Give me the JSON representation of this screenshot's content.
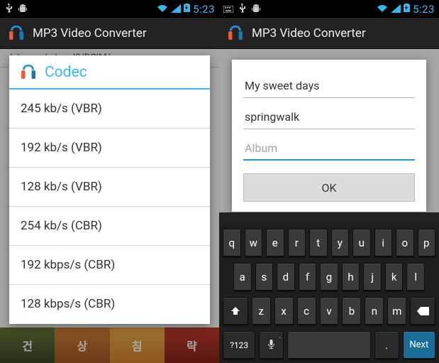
{
  "status": {
    "time": "5:23",
    "icons_left": [
      "usb",
      "android-debug"
    ],
    "icons_left_right_variant": [
      "keyboard",
      "usb",
      "android-debug"
    ],
    "icons_right": [
      "wifi",
      "signal",
      "battery-charging"
    ]
  },
  "action_bar": {
    "title": "MP3 Video Converter"
  },
  "left_panel": {
    "path": "/storage/sdcard0/DCIM/",
    "dialog_title": "Codec",
    "options": [
      "245 kb/s (VBR)",
      "192  kb/s (VBR)",
      "128  kb/s (VBR)",
      "254 kb/s (CBR)",
      "192 kbps/s (CBR)",
      "128 kbps/s (CBR)"
    ],
    "ads": [
      "건",
      "상",
      "침",
      "략"
    ]
  },
  "right_panel": {
    "fields": {
      "title": "My sweet days",
      "artist": "springwalk",
      "album_value": "",
      "album_placeholder": "Album"
    },
    "ok_label": "OK"
  },
  "keyboard": {
    "row1": [
      "q",
      "w",
      "e",
      "r",
      "t",
      "y",
      "u",
      "i",
      "o",
      "p"
    ],
    "row2": [
      "a",
      "s",
      "d",
      "f",
      "g",
      "h",
      "j",
      "k",
      "l"
    ],
    "row3_letters": [
      "z",
      "x",
      "c",
      "v",
      "b",
      "n",
      "m"
    ],
    "switch": "?123",
    "punct": [
      ",",
      "."
    ],
    "next": "Next"
  }
}
